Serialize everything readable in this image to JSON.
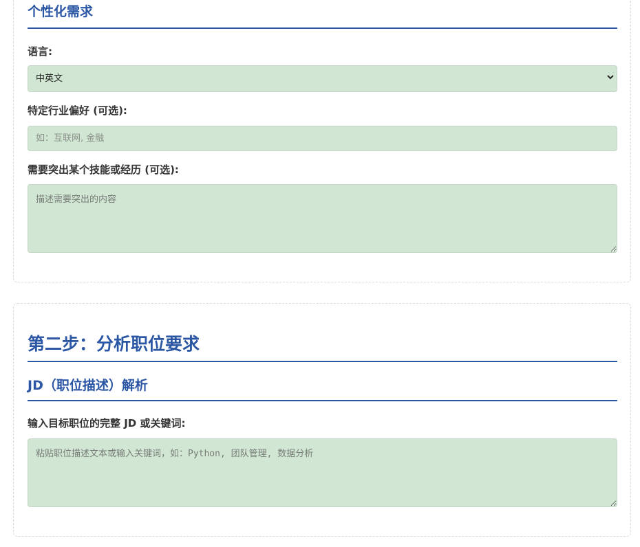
{
  "personalization": {
    "title": "个性化需求",
    "language_label": "语言:",
    "language_value": "中英文",
    "industry_label": "特定行业偏好 (可选):",
    "industry_placeholder": "如：互联网, 金融",
    "highlight_label": "需要突出某个技能或经历 (可选):",
    "highlight_placeholder": "描述需要突出的内容"
  },
  "step2": {
    "title": "第二步：分析职位要求",
    "jd_title": "JD（职位描述）解析",
    "jd_label": "输入目标职位的完整 JD 或关键词:",
    "jd_placeholder": "粘贴职位描述文本或输入关键词，如：Python, 团队管理, 数据分析"
  },
  "colors": {
    "heading": "#2a56a4",
    "field_background": "#d1e7d3"
  },
  "icons": {
    "select_arrow": "chevron-down-icon",
    "resize_grip": "resize-handle-icon"
  }
}
